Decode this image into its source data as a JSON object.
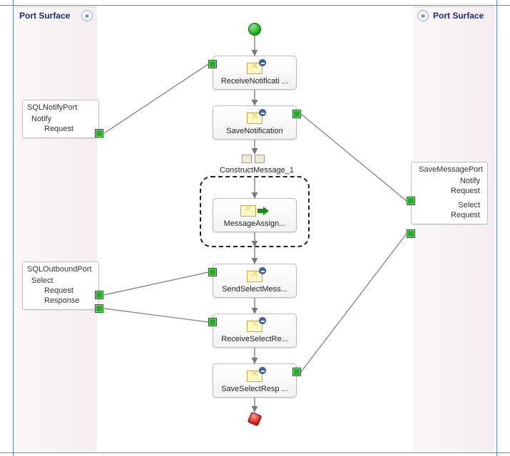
{
  "left_panel": {
    "title": "Port Surface",
    "ports": [
      {
        "name": "SQLNotifyPort",
        "ops": [
          {
            "name": "Notify",
            "channels": [
              "Request"
            ]
          }
        ]
      },
      {
        "name": "SQLOutboundPort",
        "ops": [
          {
            "name": "Select",
            "channels": [
              "Request",
              "Response"
            ]
          }
        ]
      }
    ]
  },
  "right_panel": {
    "title": "Port Surface",
    "ports": [
      {
        "name": "SaveMessagePort",
        "ops": [
          {
            "name": "Notify",
            "channels": [
              "Request"
            ]
          },
          {
            "name": "Select",
            "channels": [
              "Request"
            ]
          }
        ]
      }
    ]
  },
  "shapes": {
    "receive_notify": "ReceiveNotificati ...",
    "save_notify": "SaveNotification",
    "construct_label": "ConstructMessage_1",
    "message_assign": "MessageAssign...",
    "send_select": "SendSelectMess...",
    "receive_select": "ReceiveSelectRe...",
    "save_select_resp": "SaveSelectResp ..."
  },
  "icons": {
    "start": "start-circle",
    "end": "stop-octagon",
    "envelope": "envelope-icon",
    "arrow": "green-arrow"
  }
}
